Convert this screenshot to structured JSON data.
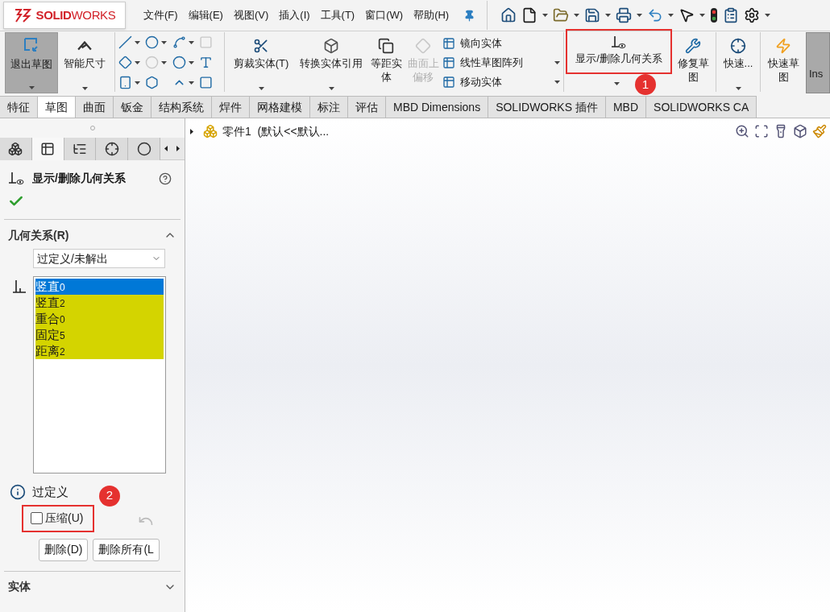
{
  "logo": {
    "text": "**SOLID**WORKS"
  },
  "menu": [
    "文件(F)",
    "编辑(E)",
    "视图(V)",
    "插入(I)",
    "工具(T)",
    "窗口(W)",
    "帮助(H)"
  ],
  "ribbon": {
    "exit_sketch": {
      "label": "退出草图",
      "pressed": true
    },
    "smart_dimension": {
      "label": "智能尺寸"
    },
    "sketch_tools": [
      {
        "dropdown": true,
        "disabled": false
      },
      {
        "dropdown": true,
        "disabled": false
      },
      {
        "dropdown": true,
        "disabled": false
      },
      {
        "dropdown": false,
        "disabled": true
      },
      {
        "dropdown": true,
        "disabled": false
      },
      {
        "dropdown": true,
        "disabled": true
      },
      {
        "dropdown": true,
        "disabled": false
      },
      {
        "dropdown": false,
        "disabled": false
      },
      {
        "dropdown": true,
        "disabled": false
      },
      {
        "dropdown": false,
        "disabled": false
      },
      {
        "dropdown": true,
        "disabled": false
      },
      {
        "dropdown": false,
        "disabled": false
      }
    ],
    "trim": {
      "label": "剪裁实体(T)"
    },
    "convert": {
      "label": "转换实体引用"
    },
    "offset": {
      "label": "等距实体"
    },
    "surface_offset": {
      "label": "曲面上偏移",
      "disabled": true
    },
    "stack": [
      {
        "label": "镜向实体",
        "dropdown": false
      },
      {
        "label": "线性草图阵列",
        "dropdown": true
      },
      {
        "label": "移动实体",
        "dropdown": true
      }
    ],
    "display_relations": {
      "label": "显示/删除几何关系"
    },
    "repair": {
      "label": "修复草图"
    },
    "quick_snaps": {
      "label": "快速..."
    },
    "rapid_sketch": {
      "label": "快速草图"
    },
    "instant2d": {
      "label": "Ins",
      "pressed": true
    }
  },
  "tabs": [
    {
      "label": "特征",
      "selected": false
    },
    {
      "label": "草图",
      "selected": true
    },
    {
      "label": "曲面",
      "selected": false
    },
    {
      "label": "钣金",
      "selected": false
    },
    {
      "label": "结构系统",
      "selected": false
    },
    {
      "label": "焊件",
      "selected": false
    },
    {
      "label": "网格建模",
      "selected": false
    },
    {
      "label": "标注",
      "selected": false
    },
    {
      "label": "评估",
      "selected": false
    },
    {
      "label": "MBD Dimensions",
      "selected": false
    },
    {
      "label": "SOLIDWORKS 插件",
      "selected": false
    },
    {
      "label": "MBD",
      "selected": false
    },
    {
      "label": "SOLIDWORKS CA",
      "selected": false
    }
  ],
  "panel": {
    "tabs": [
      {
        "selected": false
      },
      {
        "selected": true
      },
      {
        "selected": false
      },
      {
        "selected": false
      },
      {
        "selected": false
      }
    ],
    "title": "显示/删除几何关系",
    "relations": {
      "title": "几何关系(R)",
      "expanded": true,
      "filter": "过定义/未解出",
      "items": [
        {
          "label": "竖直",
          "index": "0",
          "selected": true
        },
        {
          "label": "竖直",
          "index": "2",
          "selected": false,
          "color": "#d4d400"
        },
        {
          "label": "重合",
          "index": "0",
          "selected": false,
          "color": "#d4d400"
        },
        {
          "label": "固定",
          "index": "5",
          "selected": false,
          "color": "#d4d400"
        },
        {
          "label": "距离",
          "index": "2",
          "selected": false,
          "color": "#d4d400"
        }
      ],
      "status": "过定义",
      "suppress": {
        "label": "压缩(U)",
        "checked": false
      },
      "buttons": [
        "删除(D)",
        "删除所有(L"
      ]
    },
    "entities": {
      "title": "实体",
      "expanded": false
    }
  },
  "tree": {
    "label": "零件1  (默认<<默认..."
  },
  "callouts": [
    {
      "number": "1"
    },
    {
      "number": "2"
    }
  ]
}
